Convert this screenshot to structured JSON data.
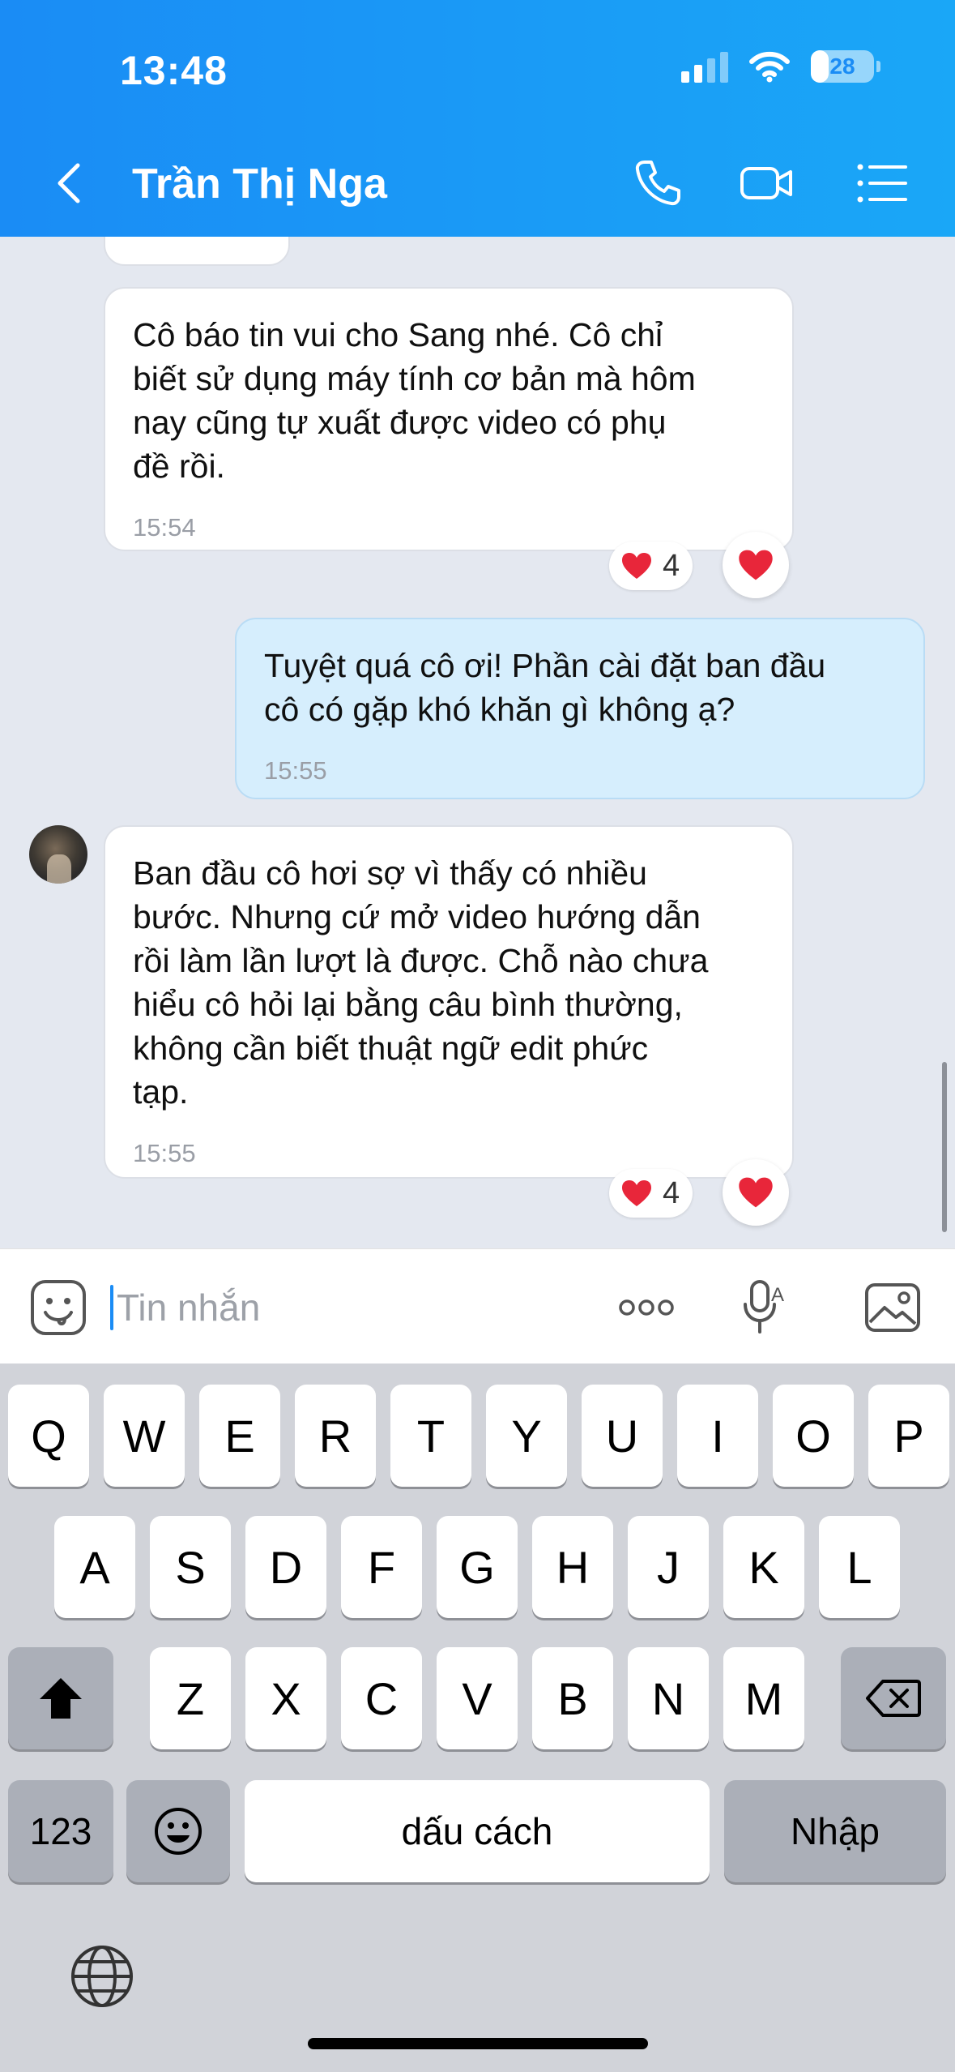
{
  "status_bar": {
    "time": "13:48",
    "battery": "28",
    "battery_level": 0.28
  },
  "header": {
    "title": "Trần Thị Nga",
    "back_icon": "chevron-left-icon",
    "call_icon": "phone-icon",
    "video_icon": "video-camera-icon",
    "menu_icon": "list-menu-icon"
  },
  "messages": [
    {
      "direction": "incoming",
      "text": "Cô báo tin vui cho Sang nhé. Cô chỉ\nbiết sử dụng máy tính cơ bản mà hôm\nnay cũng tự xuất được video có phụ\nđề rồi.",
      "time": "15:54",
      "reaction_count": "4"
    },
    {
      "direction": "outgoing",
      "text": "Tuyệt quá cô ơi! Phần cài đặt ban đầu\ncô có gặp khó khăn gì không ạ?",
      "time": "15:55"
    },
    {
      "direction": "incoming",
      "text": "Ban đầu cô hơi sợ vì thấy có nhiều\nbước. Nhưng cứ mở video hướng dẫn\nrồi làm lần lượt là được. Chỗ nào chưa\nhiểu cô hỏi lại bằng câu bình thường,\nkhông cần biết thuật ngữ edit phức\ntạp.",
      "time": "15:55",
      "reaction_count": "4"
    }
  ],
  "input_bar": {
    "placeholder": "Tin nhắn"
  },
  "keyboard": {
    "row1": [
      "Q",
      "W",
      "E",
      "R",
      "T",
      "Y",
      "U",
      "I",
      "O",
      "P"
    ],
    "row2": [
      "A",
      "S",
      "D",
      "F",
      "G",
      "H",
      "J",
      "K",
      "L"
    ],
    "row3": [
      "Z",
      "X",
      "C",
      "V",
      "B",
      "N",
      "M"
    ],
    "numbers_label": "123",
    "space_label": "dấu cách",
    "return_label": "Nhập"
  },
  "colors": {
    "header": "#1a8cf5",
    "outgoing_bubble": "#d6eefd",
    "heart": "#e8263a"
  }
}
